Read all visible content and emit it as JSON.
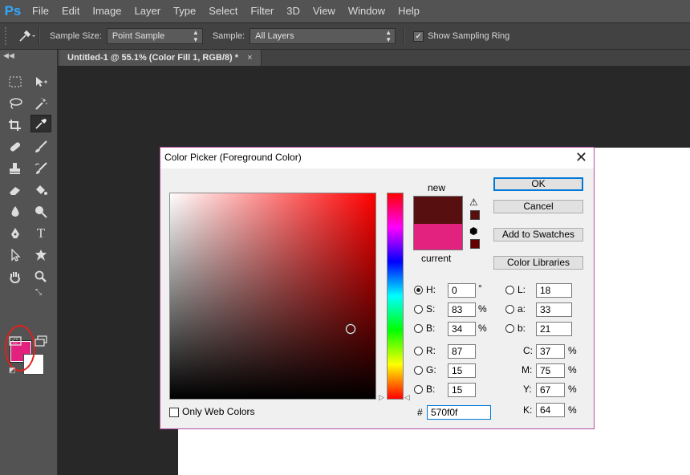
{
  "app": {
    "logo": "Ps"
  },
  "menu": [
    "File",
    "Edit",
    "Image",
    "Layer",
    "Type",
    "Select",
    "Filter",
    "3D",
    "View",
    "Window",
    "Help"
  ],
  "options_bar": {
    "sample_size_label": "Sample Size:",
    "sample_size_value": "Point Sample",
    "sample_label": "Sample:",
    "sample_value": "All Layers",
    "show_ring_label": "Show Sampling Ring",
    "show_ring_checked": true
  },
  "document_tab": {
    "title": "Untitled-1 @ 55.1% (Color Fill 1, RGB/8) *",
    "close": "×"
  },
  "tools": [
    "marquee-icon",
    "move-icon",
    "lasso-icon",
    "magic-wand-icon",
    "crop-icon",
    "eyedropper-icon",
    "healing-brush-icon",
    "brush-icon",
    "clone-stamp-icon",
    "history-brush-icon",
    "eraser-icon",
    "paint-bucket-icon",
    "blur-icon",
    "dodge-icon",
    "pen-icon",
    "type-icon",
    "path-selection-icon",
    "shape-icon",
    "hand-icon",
    "zoom-icon",
    "quick-mask-icon",
    "screen-mode-icon"
  ],
  "colors": {
    "foreground": "#e32280",
    "background": "#ffffff",
    "new_color": "#570f0f",
    "current_color": "#e32280",
    "annotation_circle": "#e2201d"
  },
  "color_picker": {
    "title": "Color Picker (Foreground Color)",
    "close": "✕",
    "new_label": "new",
    "current_label": "current",
    "buttons": {
      "ok": "OK",
      "cancel": "Cancel",
      "add_to_swatches": "Add to Swatches",
      "color_libraries": "Color Libraries"
    },
    "fields": {
      "H": {
        "label": "H:",
        "value": "0",
        "unit": "°",
        "selected": true
      },
      "S": {
        "label": "S:",
        "value": "83",
        "unit": "%"
      },
      "B": {
        "label": "B:",
        "value": "34",
        "unit": "%"
      },
      "R": {
        "label": "R:",
        "value": "87"
      },
      "G": {
        "label": "G:",
        "value": "15"
      },
      "Bl": {
        "label": "B:",
        "value": "15"
      },
      "L": {
        "label": "L:",
        "value": "18"
      },
      "a": {
        "label": "a:",
        "value": "33"
      },
      "b": {
        "label": "b:",
        "value": "21"
      },
      "C": {
        "label": "C:",
        "value": "37",
        "unit": "%"
      },
      "M": {
        "label": "M:",
        "value": "75",
        "unit": "%"
      },
      "Y": {
        "label": "Y:",
        "value": "67",
        "unit": "%"
      },
      "K": {
        "label": "K:",
        "value": "64",
        "unit": "%"
      }
    },
    "hex_label": "#",
    "hex_value": "570f0f",
    "only_web_colors_label": "Only Web Colors",
    "only_web_colors_checked": false
  }
}
